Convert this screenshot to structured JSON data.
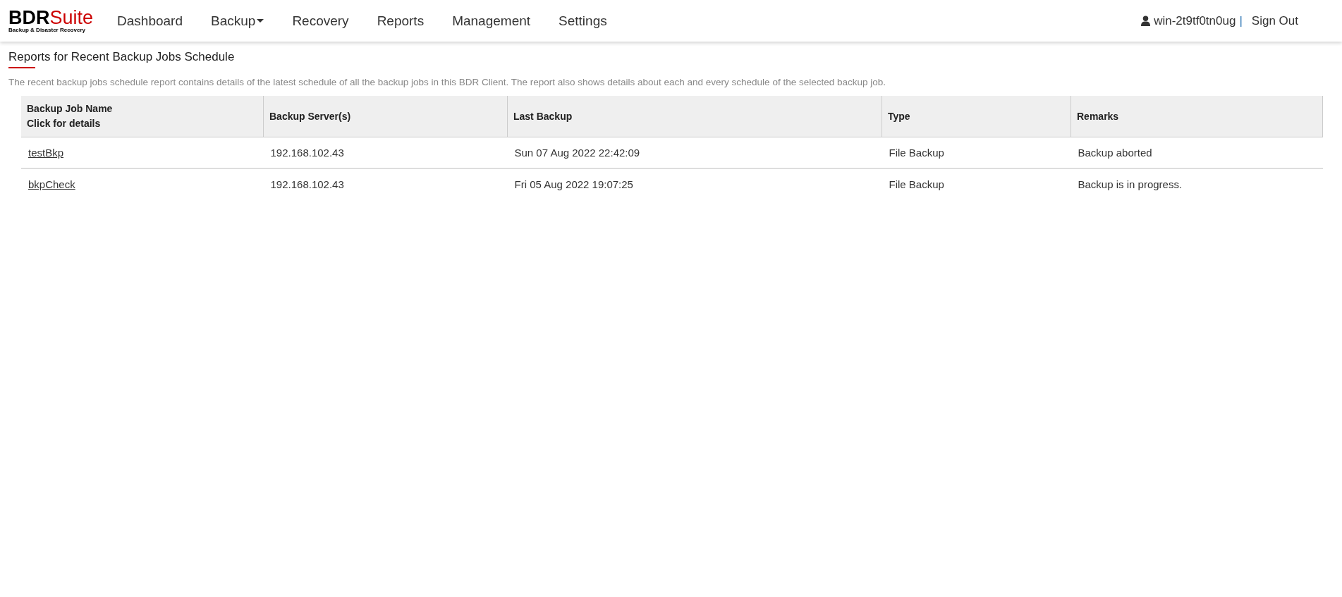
{
  "logo": {
    "part_1": "BDR",
    "part_2": "Suite",
    "tagline": "Backup & Disaster Recovery"
  },
  "nav": [
    {
      "label": "Dashboard",
      "has_menu": false
    },
    {
      "label": "Backup",
      "has_menu": true
    },
    {
      "label": "Recovery",
      "has_menu": false
    },
    {
      "label": "Reports",
      "has_menu": false
    },
    {
      "label": "Management",
      "has_menu": false
    },
    {
      "label": "Settings",
      "has_menu": false
    }
  ],
  "user": {
    "name": "win-2t9tf0tn0ug",
    "separator": "|",
    "sign_out": "Sign Out"
  },
  "page": {
    "title": "Reports for Recent Backup Jobs Schedule",
    "description": "The recent backup jobs schedule report contains details of the latest schedule of all the backup jobs in this BDR Client. The report also shows details about each and every schedule of the selected backup job."
  },
  "table": {
    "columns": [
      {
        "lines": [
          "Backup Job Name",
          "Click for details"
        ]
      },
      {
        "lines": [
          "Backup Server(s)"
        ]
      },
      {
        "lines": [
          "Last Backup"
        ]
      },
      {
        "lines": [
          "Type"
        ]
      },
      {
        "lines": [
          "Remarks"
        ]
      }
    ],
    "rows": [
      {
        "job": "testBkp",
        "server": "192.168.102.43",
        "last_backup": "Sun 07 Aug 2022 22:42:09",
        "type": "File Backup",
        "remarks": "Backup aborted"
      },
      {
        "job": "bkpCheck",
        "server": "192.168.102.43",
        "last_backup": "Fri 05 Aug 2022 19:07:25",
        "type": "File Backup",
        "remarks": "Backup is in progress."
      }
    ]
  }
}
